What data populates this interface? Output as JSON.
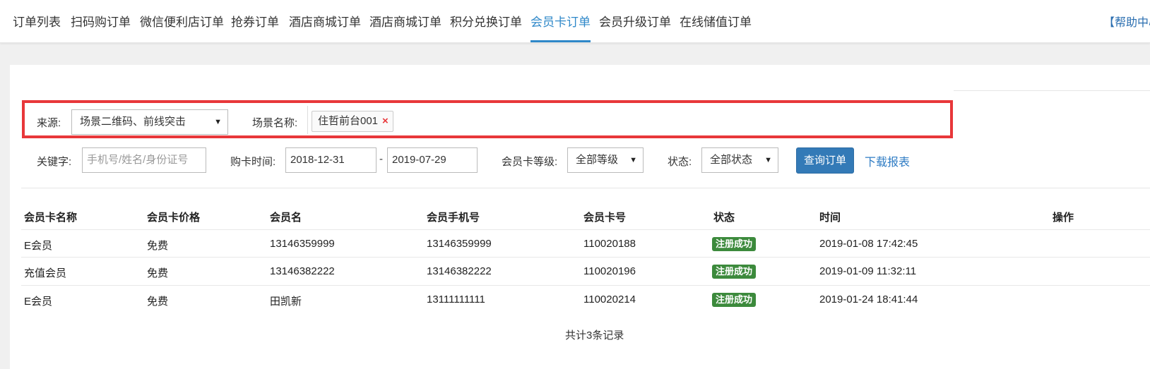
{
  "nav": {
    "tabs": [
      "订单列表",
      "扫码购订单",
      "微信便利店订单",
      "抢券订单",
      "酒店商城订单",
      "酒店商城订单",
      "积分兑换订单",
      "会员卡订单",
      "会员升级订单",
      "在线储值订单"
    ],
    "active_tab": "会员卡订单",
    "help": "【帮助中心"
  },
  "filters": {
    "source_label": "来源:",
    "source_value": "场景二维码、前线突击",
    "scene_label": "场景名称:",
    "scene_tag": "住哲前台001",
    "scene_tag_remove": "×",
    "keyword_label": "关键字:",
    "keyword_placeholder": "手机号/姓名/身份证号",
    "date_label": "购卡时间:",
    "date_from": "2018-12-31",
    "date_sep": "-",
    "date_to": "2019-07-29",
    "level_label": "会员卡等级:",
    "level_value": "全部等级",
    "status_label": "状态:",
    "status_value": "全部状态",
    "query_button": "查询订单",
    "download_link": "下载报表",
    "arrow": "▼"
  },
  "table": {
    "headers": [
      "会员卡名称",
      "会员卡价格",
      "会员名",
      "会员手机号",
      "会员卡号",
      "状态",
      "时间",
      "操作"
    ],
    "rows": [
      {
        "card_name": "E会员",
        "price": "免费",
        "member": "13146359999",
        "phone": "13146359999",
        "card_no": "110020188",
        "status": "注册成功",
        "time": "2019-01-08 17:42:45"
      },
      {
        "card_name": "充值会员",
        "price": "免费",
        "member": "13146382222",
        "phone": "13146382222",
        "card_no": "110020196",
        "status": "注册成功",
        "time": "2019-01-09 11:32:11"
      },
      {
        "card_name": "E会员",
        "price": "免费",
        "member": "田凯新",
        "phone": "13111111111",
        "card_no": "110020214",
        "status": "注册成功",
        "time": "2019-01-24 18:41:44"
      }
    ],
    "total": "共计3条记录"
  },
  "colors": {
    "accent": "#2f88c9",
    "highlight_border": "#e8373a",
    "badge_green": "#3c8a3c",
    "primary_button": "#337ab7"
  }
}
